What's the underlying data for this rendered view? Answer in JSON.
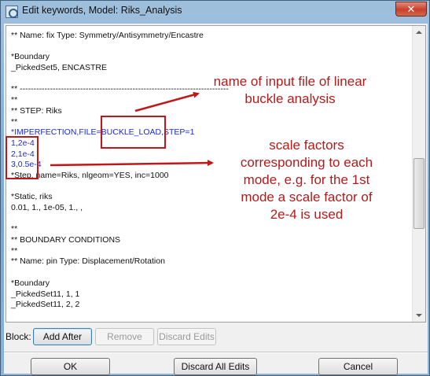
{
  "window": {
    "title": "Edit keywords, Model: Riks_Analysis",
    "close_glyph": "✕"
  },
  "editor": {
    "lines": [
      "** Name: fix Type: Symmetry/Antisymmetry/Encastre",
      "",
      "*Boundary",
      "_PickedSet5, ENCASTRE",
      "",
      "** ----------------------------------------------------------------------------",
      "**",
      "** STEP: Riks",
      "**",
      "*IMPERFECTION,FILE=BUCKLE_LOAD,STEP=1",
      "1,2e-4",
      "2,1e-4",
      "3,0.5e-4",
      "*Step, name=Riks, nlgeom=YES, inc=1000",
      "",
      "*Static, riks",
      "0.01, 1., 1e-05, 1., ,",
      "",
      "**",
      "** BOUNDARY CONDITIONS",
      "**",
      "** Name: pin Type: Displacement/Rotation",
      "",
      "*Boundary",
      "_PickedSet11, 1, 1",
      "_PickedSet11, 2, 2"
    ]
  },
  "annotations": {
    "input_file_note": [
      "name of input file of linear",
      "buckle analysis"
    ],
    "scale_factor_note": [
      "scale factors",
      "corresponding to each",
      "mode, e.g. for the 1st",
      "mode a scale factor of",
      "2e-4 is used"
    ],
    "color": "#b31b1b"
  },
  "block": {
    "label": "Block:",
    "add_after": "Add After",
    "remove": "Remove",
    "discard_edits": "Discard Edits"
  },
  "footer": {
    "ok": "OK",
    "discard_all_edits": "Discard All Edits",
    "cancel": "Cancel"
  }
}
